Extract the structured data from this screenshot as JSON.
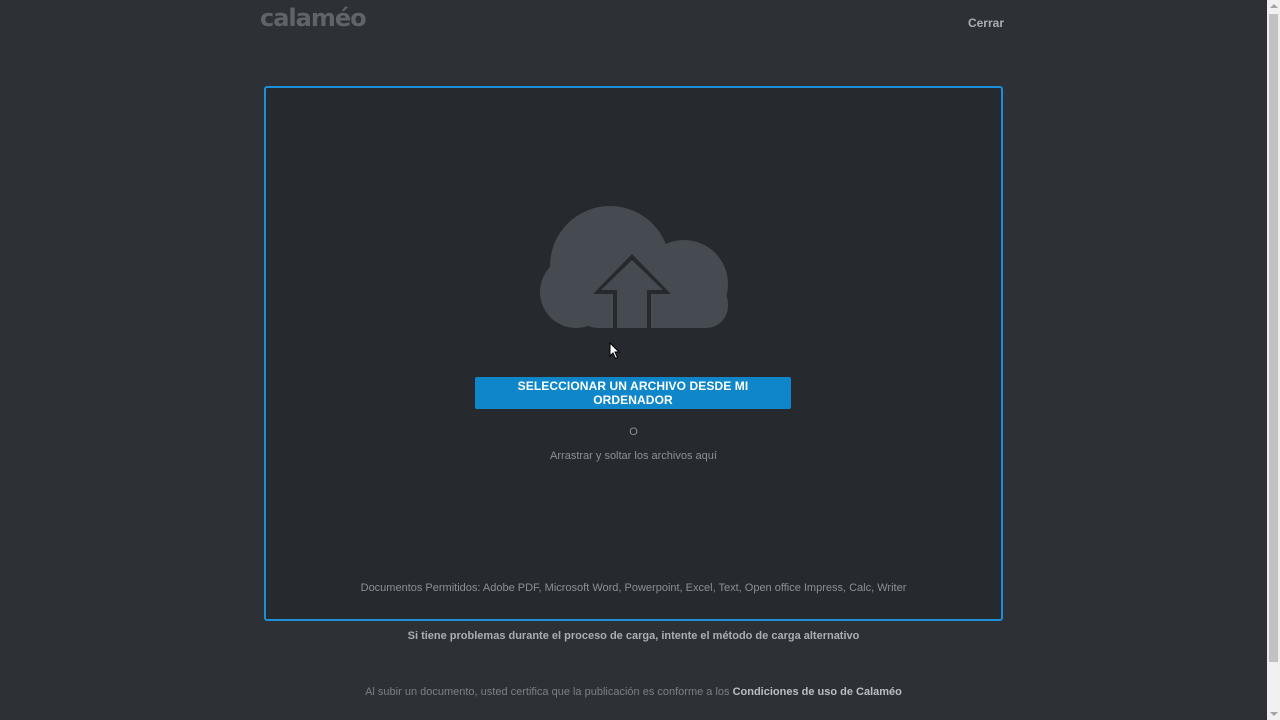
{
  "header": {
    "logo": "calaméo",
    "close_label": "Cerrar"
  },
  "upload": {
    "icon": "cloud-upload-icon",
    "button_label": "SELECCIONAR UN ARCHIVO DESDE MI ORDENADOR",
    "or_label": "O",
    "drag_text": "Arrastrar y soltar los archivos aquí",
    "allowed_formats": "Documentos Permitidos: Adobe PDF, Microsoft Word, Powerpoint, Excel, Text, Open office Impress, Calc, Writer"
  },
  "footer": {
    "problem_text": "Si tiene problemas durante el proceso de carga, intente el método de carga alternativo",
    "terms_prefix": "Al subir un documento, usted certifica que la publicación es conforme a los ",
    "terms_link": "Condiciones de uso de Calaméo"
  },
  "colors": {
    "background": "#2d3135",
    "accent": "#0e86c9",
    "dropzone_border": "#1d8fd8"
  }
}
